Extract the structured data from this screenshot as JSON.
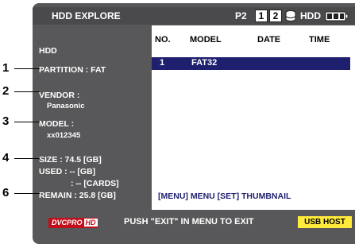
{
  "header": {
    "title": "HDD EXPLORE",
    "p2": "P2",
    "slot1": "1",
    "slot2": "2",
    "hdd_label": "HDD"
  },
  "info": {
    "heading": "HDD",
    "partition": "PARTITION : FAT",
    "vendor_label": "VENDOR :",
    "vendor_value": "Panasonic",
    "model_label": "MODEL :",
    "model_value": "xx012345",
    "size": "SIZE :  74.5 [GB]",
    "used": "USED : -- [GB]",
    "cards": ": -- [CARDS]",
    "remain": "REMAIN :  25.8 [GB]"
  },
  "table": {
    "headers": [
      "NO.",
      "MODEL",
      "DATE",
      "TIME"
    ],
    "rows": [
      {
        "no": "1",
        "model": "FAT32",
        "date": "",
        "time": ""
      }
    ]
  },
  "hint": "[MENU] MENU   [SET] THUMBNAIL",
  "footer": {
    "logo_text": "DVCPRO",
    "logo_hd": "HD",
    "message": "PUSH \"EXIT\" IN MENU TO EXIT",
    "usb": "USB HOST"
  },
  "callouts": [
    "1",
    "2",
    "3",
    "4",
    "6"
  ],
  "colors": {
    "screen_bg": "#58585a",
    "selection": "#1e1f6e",
    "usb_badge": "#ffeb3b",
    "logo_red": "#c20f1b"
  }
}
